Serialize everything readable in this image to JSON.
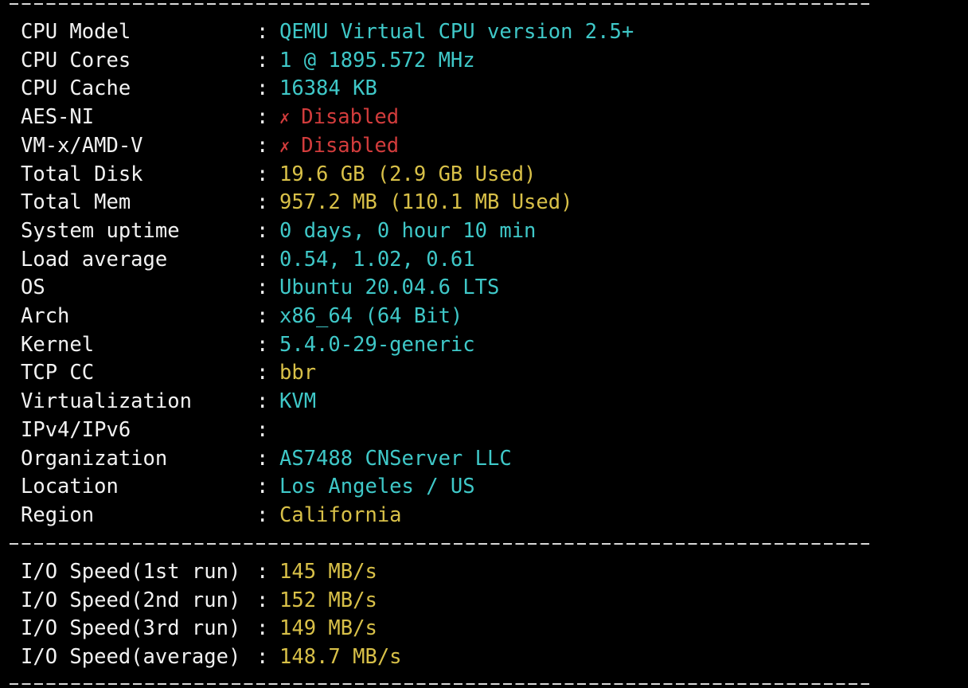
{
  "colors": {
    "background": "#000000",
    "label": "#f2f2f2",
    "cyan": "#3fc8c8",
    "yellow": "#d8c048",
    "red": "#d23c3c"
  },
  "system_info": [
    {
      "label": "CPU Model",
      "value": "QEMU Virtual CPU version 2.5+",
      "color": "cyan"
    },
    {
      "label": "CPU Cores",
      "value": "1 @ 1895.572 MHz",
      "color": "cyan"
    },
    {
      "label": "CPU Cache",
      "value": "16384 KB",
      "color": "cyan"
    },
    {
      "label": "AES-NI",
      "value": "Disabled",
      "color": "red",
      "icon": "cross-icon"
    },
    {
      "label": "VM-x/AMD-V",
      "value": "Disabled",
      "color": "red",
      "icon": "cross-icon"
    },
    {
      "label": "Total Disk",
      "value": "19.6 GB (2.9 GB Used)",
      "color": "yellow"
    },
    {
      "label": "Total Mem",
      "value": "957.2 MB (110.1 MB Used)",
      "color": "yellow"
    },
    {
      "label": "System uptime",
      "value": "0 days, 0 hour 10 min",
      "color": "cyan"
    },
    {
      "label": "Load average",
      "value": "0.54, 1.02, 0.61",
      "color": "cyan"
    },
    {
      "label": "OS",
      "value": "Ubuntu 20.04.6 LTS",
      "color": "cyan"
    },
    {
      "label": "Arch",
      "value": "x86_64 (64 Bit)",
      "color": "cyan"
    },
    {
      "label": "Kernel",
      "value": "5.4.0-29-generic",
      "color": "cyan"
    },
    {
      "label": "TCP CC",
      "value": "bbr",
      "color": "yellow"
    },
    {
      "label": "Virtualization",
      "value": "KVM",
      "color": "cyan"
    },
    {
      "label": "IPv4/IPv6",
      "value": "",
      "color": "cyan"
    },
    {
      "label": "Organization",
      "value": "AS7488 CNServer LLC",
      "color": "cyan"
    },
    {
      "label": "Location",
      "value": "Los Angeles / US",
      "color": "cyan"
    },
    {
      "label": "Region",
      "value": "California",
      "color": "yellow"
    }
  ],
  "io_speed": [
    {
      "label": "I/O Speed(1st run)",
      "value": "145 MB/s",
      "color": "yellow"
    },
    {
      "label": "I/O Speed(2nd run)",
      "value": "152 MB/s",
      "color": "yellow"
    },
    {
      "label": "I/O Speed(3rd run)",
      "value": "149 MB/s",
      "color": "yellow"
    },
    {
      "label": "I/O Speed(average)",
      "value": "148.7 MB/s",
      "color": "yellow"
    }
  ],
  "separator": ":",
  "cross_glyph": "✗"
}
